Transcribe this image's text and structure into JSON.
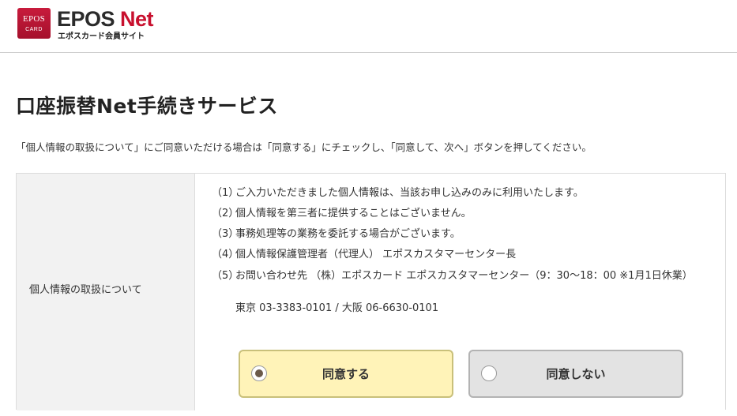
{
  "header": {
    "logo_card_line1": "EPOS",
    "logo_card_line2": "CARD",
    "logo_brand": "EPOS",
    "logo_net": "Net",
    "logo_subtitle": "エポスカード会員サイト"
  },
  "main": {
    "title": "口座振替Net手続きサービス",
    "instruction": "「個人情報の取扱について」にご同意いただける場合は「同意する」にチェックし、「同意して、次へ」ボタンを押してください。"
  },
  "panel": {
    "label": "個人情報の取扱について",
    "items": [
      {
        "num": "（1）",
        "text": "ご入力いただきました個人情報は、当該お申し込みのみに利用いたします。"
      },
      {
        "num": "（2）",
        "text": "個人情報を第三者に提供することはございません。"
      },
      {
        "num": "（3）",
        "text": "事務処理等の業務を委託する場合がございます。"
      },
      {
        "num": "（4）",
        "text": "個人情報保護管理者（代理人） エポスカスタマーセンター長"
      },
      {
        "num": "（5）",
        "text": "お問い合わせ先 （株）エポスカード エポスカスタマーセンター（9：30〜18：00 ※1月1日休業）",
        "text2": "東京 03-3383-0101 / 大阪 06-6630-0101"
      }
    ]
  },
  "choices": {
    "agree_label": "同意する",
    "disagree_label": "同意しない",
    "selected": "agree"
  },
  "colors": {
    "brand_red": "#c8102e",
    "agree_bg": "#fff3b8",
    "disagree_bg": "#e3e3e3"
  }
}
